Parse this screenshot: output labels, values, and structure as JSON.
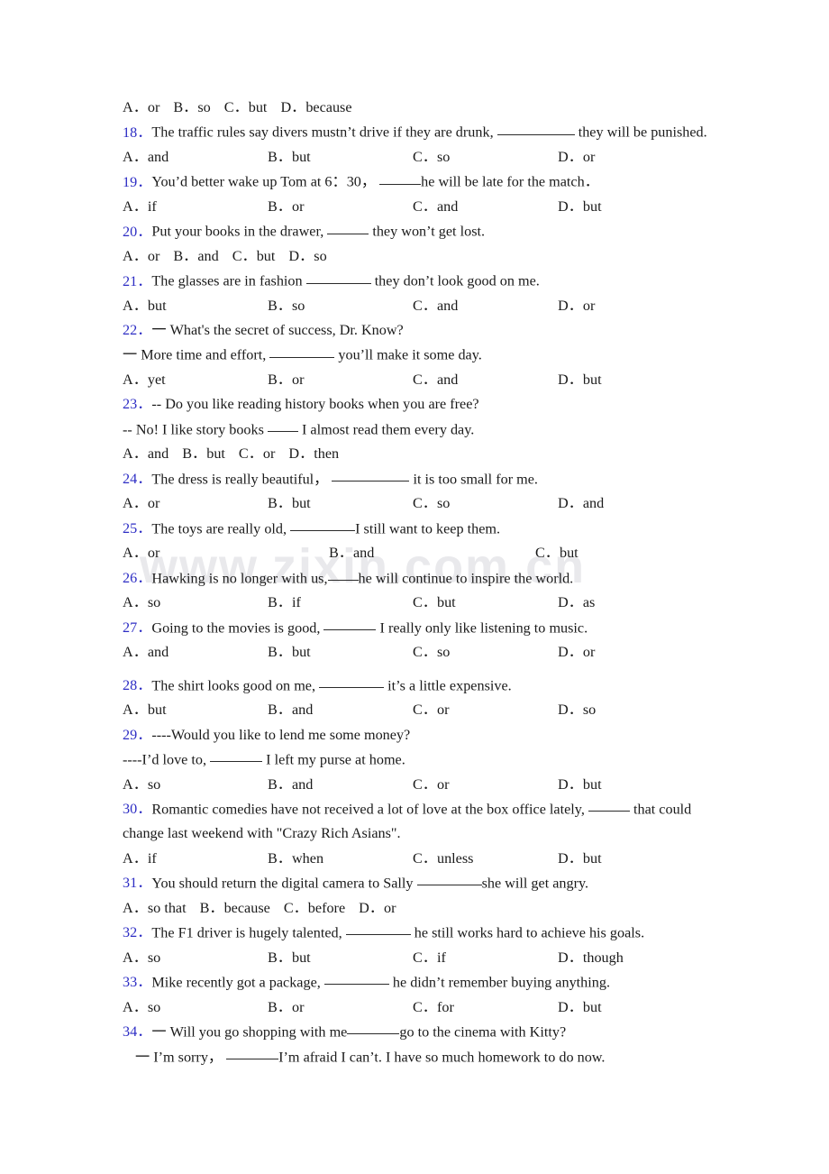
{
  "watermark": {
    "text": "www.zixin.com.cn"
  },
  "colors": {
    "question_number": "#2d2dc4",
    "body_text": "#1a1a1a",
    "watermark": "#e9e9ec",
    "page_background": "#ffffff"
  },
  "lead_options": {
    "a": "A．or",
    "b": "B．so",
    "c": "C．but",
    "d": "D．because"
  },
  "questions": [
    {
      "number": "18．",
      "stem_before": "The traffic rules say divers mustn’t drive if they are drunk,",
      "stem_after": "they will be punished.",
      "options": [
        "A．and",
        "B．but",
        "C．so",
        "D．or"
      ]
    },
    {
      "number": "19．",
      "stem_before": "You’d better wake up Tom at 6：30，",
      "stem_after": "he will be late for the match．",
      "options": [
        "A．if",
        "B．or",
        "C．and",
        "D．but"
      ]
    },
    {
      "number": "20．",
      "stem_before": "Put your books in the drawer,",
      "stem_after": "they won’t get lost.",
      "options": [
        "A．or",
        "B．and",
        "C．but",
        "D．so"
      ]
    },
    {
      "number": "21．",
      "stem_before": "The glasses are in fashion",
      "stem_after": "they don’t look good on me.",
      "options": [
        "A．but",
        "B．so",
        "C．and",
        "D．or"
      ]
    },
    {
      "number": "22．",
      "dialog_q": "一 What's the secret of success, Dr. Know?",
      "dialog_a_before": "一 More time and effort,",
      "dialog_a_after": "you’ll make it some day.",
      "options": [
        "A．yet",
        "B．or",
        "C．and",
        "D．but"
      ]
    },
    {
      "number": "23．",
      "dialog_q": "-- Do you like reading history books when you are free?",
      "dialog_a_before": "-- No! I like story books",
      "dialog_a_after": "I almost read them every day.",
      "options": [
        "A．and",
        "B．but",
        "C．or",
        "D．then"
      ]
    },
    {
      "number": "24．",
      "stem_before": "The dress is really beautiful，",
      "stem_after": "it is too small for me.",
      "options": [
        "A．or",
        "B．but",
        "C．so",
        "D．and"
      ]
    },
    {
      "number": "25．",
      "stem_before": "The toys are really old,",
      "stem_after": "I still want to keep them.",
      "options": [
        "A．or",
        "B．and",
        "C．but"
      ]
    },
    {
      "number": "26．",
      "stem_before": "Hawking is no longer with us,",
      "stem_after": "he will continue to inspire the world.",
      "options": [
        "A．so",
        "B．if",
        "C．but",
        "D．as"
      ]
    },
    {
      "number": "27．",
      "stem_before": "Going to the movies is good,",
      "stem_after": "I really only like listening to music.",
      "options": [
        "A．and",
        "B．but",
        "C．so",
        "D．or"
      ]
    },
    {
      "number": "28．",
      "stem_before": "The shirt looks good on me,",
      "stem_after": "it’s a little expensive.",
      "options": [
        "A．but",
        "B．and",
        "C．or",
        "D．so"
      ]
    },
    {
      "number": "29．",
      "dialog_q": "----Would you like to lend me some money?",
      "dialog_a_before": "----I’d love to,",
      "dialog_a_after": "I left my purse at home.",
      "options": [
        "A．so",
        "B．and",
        "C．or",
        "D．but"
      ]
    },
    {
      "number": "30．",
      "stem_before": "Romantic comedies have not received a lot of love at the box office lately,",
      "stem_after": "that could change last weekend with \"Crazy Rich Asians\".",
      "options": [
        "A．if",
        "B．when",
        "C．unless",
        "D．but"
      ]
    },
    {
      "number": "31．",
      "stem_before": "You should return the digital camera to Sally",
      "stem_after": "she will get angry.",
      "options": [
        "A．so that",
        "B．because",
        "C．before",
        "D．or"
      ]
    },
    {
      "number": "32．",
      "stem_before": "The F1 driver is hugely talented,",
      "stem_after": "he still works hard to achieve his goals.",
      "options": [
        "A．so",
        "B．but",
        "C．if",
        "D．though"
      ]
    },
    {
      "number": "33．",
      "stem_before": "Mike recently got a package,",
      "stem_after": "he didn’t remember buying anything.",
      "options": [
        "A．so",
        "B．or",
        "C．for",
        "D．but"
      ]
    },
    {
      "number": "34．",
      "dialog_q_before": "一 Will you go shopping with me",
      "dialog_q_after": "go to the cinema with Kitty?",
      "dialog_a_before": "一 I’m sorry，",
      "dialog_a_after": "I’m afraid I can’t.  I have so much homework to do now."
    }
  ]
}
